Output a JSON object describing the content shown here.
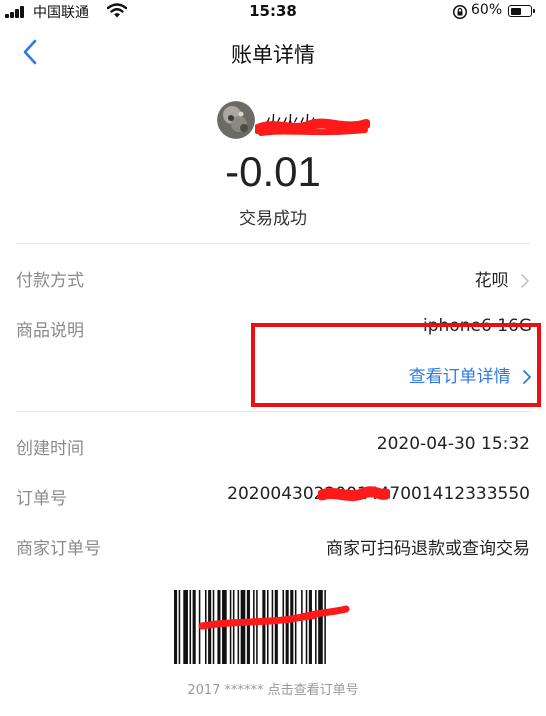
{
  "status_bar": {
    "carrier": "中国联通",
    "time": "15:38",
    "battery": "60%",
    "battery_level": 0.6
  },
  "nav": {
    "title": "账单详情"
  },
  "merchant": {
    "name": "火火火",
    "avatar": "merchant-avatar"
  },
  "summary": {
    "amount": "-0.01",
    "status": "交易成功"
  },
  "details": {
    "payment_method_label": "付款方式",
    "payment_method_value": "花呗",
    "goods_label": "商品说明",
    "goods_value": "iphone6 16G",
    "order_detail_link": "查看订单详情",
    "created_label": "创建时间",
    "created_value": "2020-04-30 15:32",
    "order_no_label": "订单号",
    "order_no_value": "2020043022001447001412333550",
    "merchant_order_label": "商家订单号",
    "merchant_order_value": "商家可扫码退款或查询交易"
  },
  "barcode": {
    "caption": "2017 ****** 点击查看订单号"
  },
  "colors": {
    "accent": "#2f7ae5",
    "annotation": "#e81010",
    "muted_label": "#8a8a8a"
  }
}
